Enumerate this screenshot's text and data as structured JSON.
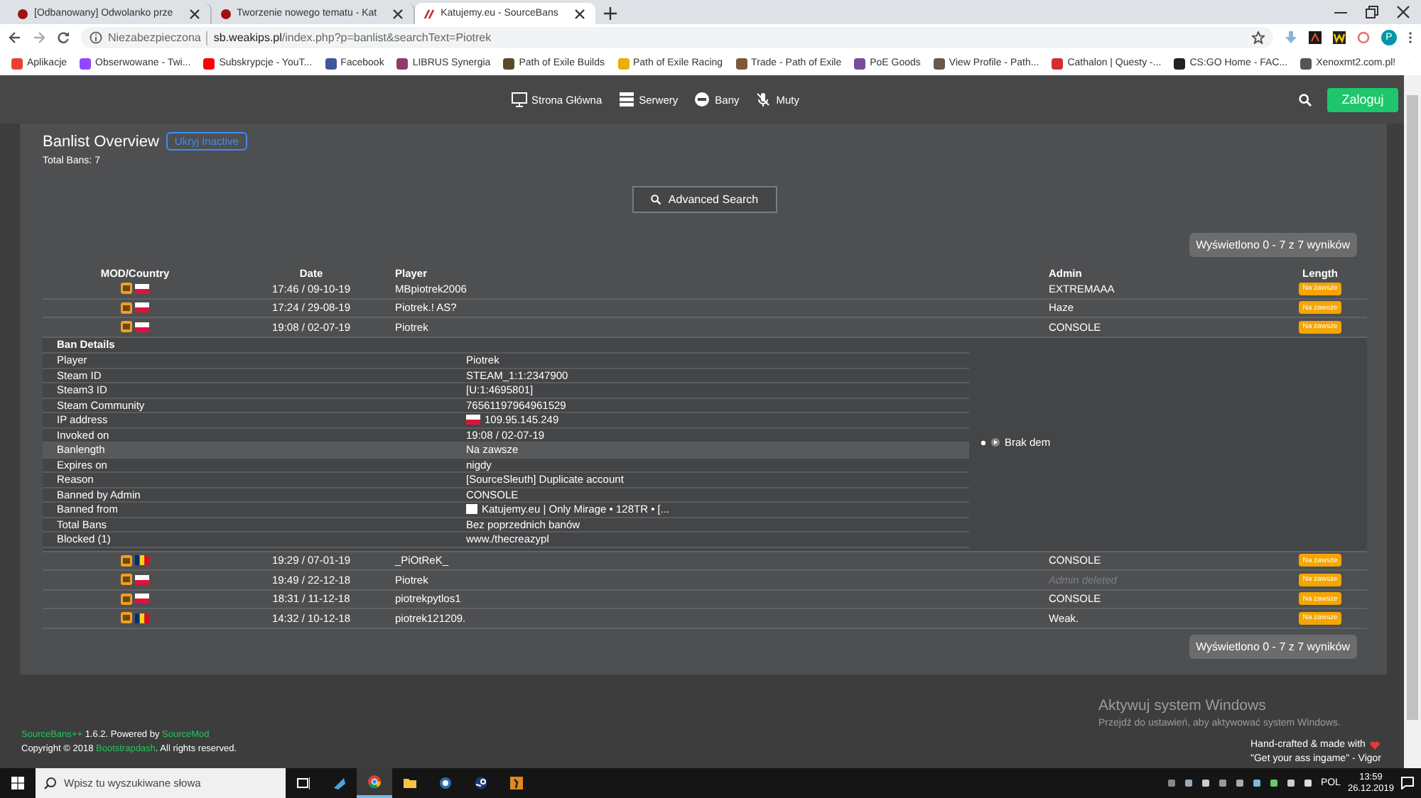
{
  "browser": {
    "tabs": [
      {
        "title": "[Odbanowany] Odwolanko prze",
        "selected": false
      },
      {
        "title": "Tworzenie nowego tematu - Kat",
        "selected": false
      },
      {
        "title": "Katujemy.eu - SourceBans",
        "selected": true
      }
    ],
    "security": "Niezabezpieczona",
    "host": "sb.weakips.pl",
    "path": "/index.php?p=banlist&searchText=Piotrek",
    "profile_initial": "P",
    "bookmarks": [
      {
        "label": "Aplikacje",
        "color": "#e94235"
      },
      {
        "label": "Obserwowane - Twi...",
        "color": "#9146ff"
      },
      {
        "label": "Subskrypcje - YouT...",
        "color": "#ff0000"
      },
      {
        "label": "Facebook",
        "color": "#3b5998"
      },
      {
        "label": "LIBRUS Synergia",
        "color": "#8e3a6e"
      },
      {
        "label": "Path of Exile Builds",
        "color": "#5a4a2a"
      },
      {
        "label": "Path of Exile Racing",
        "color": "#e8b000"
      },
      {
        "label": "Trade - Path of Exile",
        "color": "#7a5a3a"
      },
      {
        "label": "PoE Goods",
        "color": "#7a4a9a"
      },
      {
        "label": "View Profile - Path...",
        "color": "#6a5a4a"
      },
      {
        "label": "Cathalon | Questy -...",
        "color": "#d32f2f"
      },
      {
        "label": "CS:GO Home - FAC...",
        "color": "#222222"
      },
      {
        "label": "Xenoxmt2.com.pl!",
        "color": "#555555"
      }
    ]
  },
  "nav": {
    "items": [
      {
        "label": "Strona Główna"
      },
      {
        "label": "Serwery"
      },
      {
        "label": "Bany"
      },
      {
        "label": "Muty"
      }
    ],
    "login": "Zaloguj"
  },
  "banlist": {
    "title": "Banlist Overview",
    "toggle": "Ukryj Inactive",
    "total": "Total Bans: 7",
    "advanced_search": "Advanced Search",
    "pager_top": "Wyświetlono 0 - 7 z 7 wyników",
    "columns": [
      "MOD/Country",
      "Date",
      "Player",
      "Admin",
      "Length"
    ],
    "rows": [
      {
        "kind": "pl",
        "date": "17:46 / 09-10-19",
        "player": "MBpiotrek2006",
        "admin": "EXTREMAAA",
        "admin_deleted": false,
        "length": "Na zawsze"
      },
      {
        "kind": "pl",
        "date": "17:24 / 29-08-19",
        "player": "Piotrek.! AS?",
        "admin": "Haze",
        "admin_deleted": false,
        "length": "Na zawsze"
      },
      {
        "kind": "pl",
        "date": "19:08 / 02-07-19",
        "player": "Piotrek",
        "admin": "CONSOLE",
        "admin_deleted": false,
        "length": "Na zawsze",
        "details_shown": true
      },
      {
        "kind": "ro",
        "date": "19:29 / 07-01-19",
        "player": "_PiOtReK_",
        "admin": "CONSOLE",
        "admin_deleted": false,
        "length": "Na zawsze"
      },
      {
        "kind": "pl",
        "date": "19:49 / 22-12-18",
        "player": "Piotrek",
        "admin": "Admin deleted",
        "admin_deleted": true,
        "length": "Na zawsze"
      },
      {
        "kind": "pl",
        "date": "18:31 / 11-12-18",
        "player": "piotrekpytlos1",
        "admin": "CONSOLE",
        "admin_deleted": false,
        "length": "Na zawsze"
      },
      {
        "kind": "ro",
        "date": "14:32 / 10-12-18",
        "player": "piotrek121209.",
        "admin": "Weak.",
        "admin_deleted": false,
        "length": "Na zawsze"
      }
    ],
    "details": {
      "title": "Ban Details",
      "demo": "Brak dem",
      "fields": [
        {
          "label": "Player",
          "value": "Piotrek",
          "kind": "text",
          "highlighted": false
        },
        {
          "label": "Steam ID",
          "value": "STEAM_1:1:2347900",
          "kind": "text",
          "highlighted": false
        },
        {
          "label": "Steam3 ID",
          "value": "[U:1:4695801]",
          "kind": "text",
          "highlighted": false
        },
        {
          "label": "Steam Community",
          "value": "76561197964961529",
          "kind": "text",
          "highlighted": false
        },
        {
          "label": "IP address",
          "value": "109.95.145.249",
          "kind": "pl",
          "highlighted": false
        },
        {
          "label": "Invoked on",
          "value": "19:08 / 02-07-19",
          "kind": "text",
          "highlighted": false
        },
        {
          "label": "Banlength",
          "value": "Na zawsze",
          "kind": "text",
          "highlighted": true
        },
        {
          "label": "Expires on",
          "value": "nigdy",
          "kind": "text",
          "highlighted": false
        },
        {
          "label": "Reason",
          "value": "[SourceSleuth] Duplicate account",
          "kind": "text",
          "highlighted": false
        },
        {
          "label": "Banned by Admin",
          "value": "CONSOLE",
          "kind": "text",
          "highlighted": false
        },
        {
          "label": "Banned from",
          "value": "Katujemy.eu | Only Mirage • 128TR • [...",
          "kind": "server",
          "highlighted": false
        },
        {
          "label": "Total Bans",
          "value": "Bez poprzednich banów",
          "kind": "text",
          "highlighted": false
        },
        {
          "label": "Blocked (1)",
          "value": "www./thecreazypl",
          "kind": "text",
          "highlighted": false
        }
      ]
    },
    "pager_bottom": "Wyświetlono 0 - 7 z 7 wyników"
  },
  "activation": {
    "title": "Aktywuj system Windows",
    "text": "Przejdź do ustawień, aby aktywować system Windows."
  },
  "footer": {
    "credits": [
      {
        "text": "SourceBans++",
        "link": true
      },
      {
        "text": " 1.6.2. Powered by ",
        "link": false
      },
      {
        "text": "SourceMod",
        "link": true
      }
    ],
    "copyright": [
      {
        "text": "Copyright © 2018 ",
        "link": false
      },
      {
        "text": "Bootstrapdash",
        "link": true
      },
      {
        "text": ". All rights reserved.",
        "link": false
      }
    ],
    "made_with": "Hand-crafted & made with",
    "quote": "\"Get your ass ingame\" - Vigor"
  },
  "taskbar": {
    "search_placeholder": "Wpisz tu wyszukiwane słowa",
    "language": "POL",
    "time": "13:59",
    "date": "26.12.2019"
  }
}
